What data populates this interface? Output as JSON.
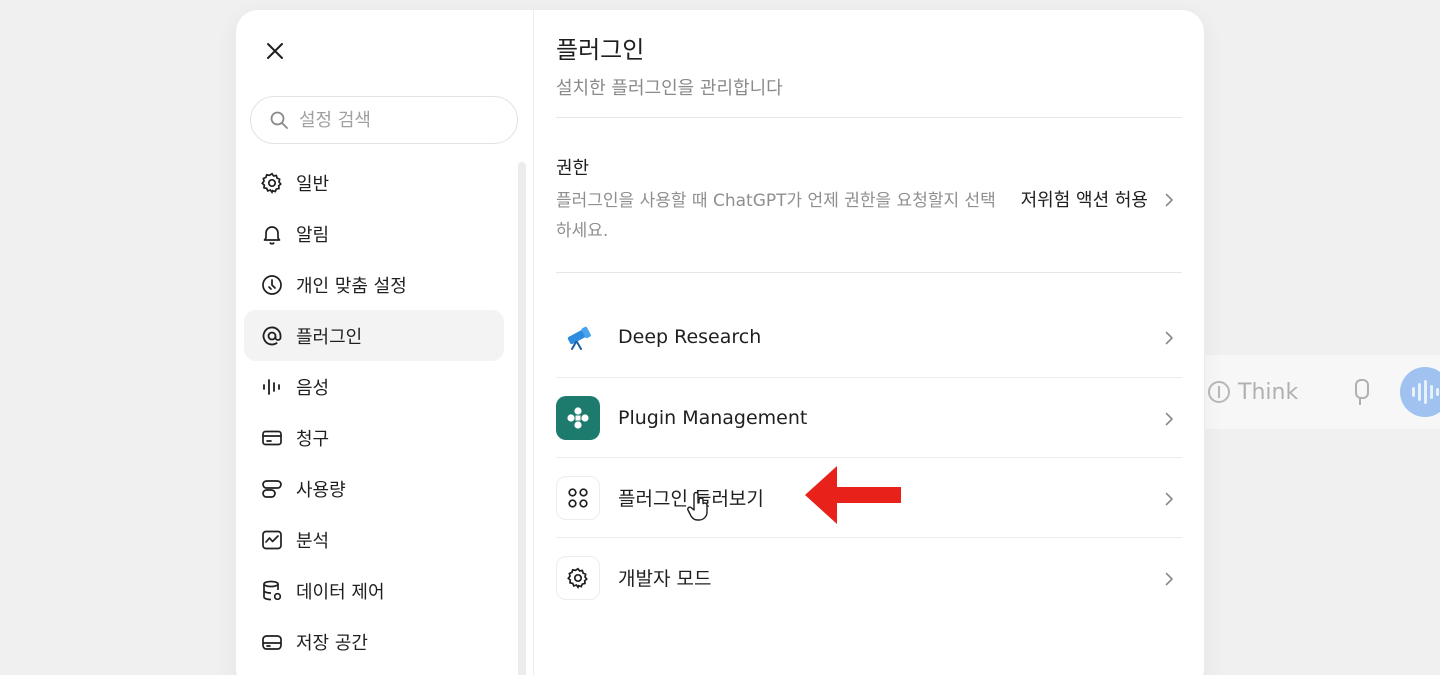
{
  "background": {
    "think_label": "Think",
    "voice_color": "#9fc2f0"
  },
  "sidebar": {
    "close_icon": "close-icon",
    "search": {
      "placeholder": "설정 검색",
      "value": ""
    },
    "items": [
      {
        "id": "general",
        "label": "일반",
        "icon": "gear-icon",
        "active": false
      },
      {
        "id": "notifications",
        "label": "알림",
        "icon": "bell-icon",
        "active": false
      },
      {
        "id": "personalization",
        "label": "개인 맞춤 설정",
        "icon": "personalization-icon",
        "active": false
      },
      {
        "id": "plugins",
        "label": "플러그인",
        "icon": "at-icon",
        "active": true
      },
      {
        "id": "voice",
        "label": "음성",
        "icon": "waveform-icon",
        "active": false
      },
      {
        "id": "billing",
        "label": "청구",
        "icon": "card-icon",
        "active": false
      },
      {
        "id": "usage",
        "label": "사용량",
        "icon": "usage-icon",
        "active": false
      },
      {
        "id": "analytics",
        "label": "분석",
        "icon": "chart-icon",
        "active": false
      },
      {
        "id": "data-controls",
        "label": "데이터 제어",
        "icon": "database-icon",
        "active": false
      },
      {
        "id": "storage",
        "label": "저장 공간",
        "icon": "storage-icon",
        "active": false
      }
    ]
  },
  "content": {
    "title": "플러그인",
    "subtitle": "설치한 플러그인을 관리합니다",
    "permissions": {
      "title": "권한",
      "description": "플러그인을 사용할 때 ChatGPT가 언제 권한을 요청할지 선택하세요.",
      "value": "저위험 액션 허용"
    },
    "rows": [
      {
        "id": "deep-research",
        "label": "Deep Research",
        "icon": "telescope-icon"
      },
      {
        "id": "plugin-management",
        "label": "Plugin Management",
        "icon": "plugin-management-icon"
      },
      {
        "id": "browse-plugins",
        "label": "플러그인 둘러보기",
        "icon": "grid-dots-icon"
      },
      {
        "id": "developer-mode",
        "label": "개발자 모드",
        "icon": "gear-icon"
      }
    ]
  },
  "colors": {
    "accent_teal": "#1d7b6e",
    "arrow_red": "#e8221b",
    "telescope_blue": "#2d8be0"
  }
}
